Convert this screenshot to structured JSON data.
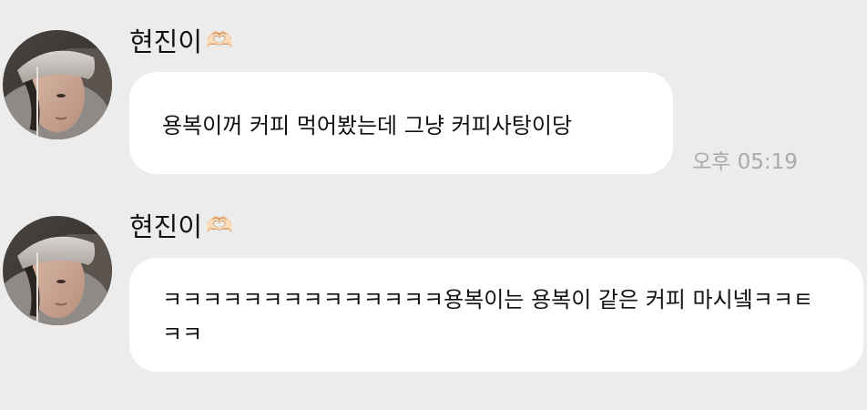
{
  "messages": [
    {
      "sender": "현진이",
      "sender_emoji": "🫶🏻",
      "text": "용복이꺼 커피 먹어봤는데 그냥 커피사탕이당",
      "time": "오후 05:19"
    },
    {
      "sender": "현진이",
      "sender_emoji": "🫶🏻",
      "text": "ㅋㅋㅋㅋㅋㅋㅋㅋㅋㅋㅋㅋㅋㅋ용복이는 용복이 같은 커피 마시넼ㅋㅋㅌㅋㅋ"
    }
  ],
  "colors": {
    "background": "#ececed",
    "bubble": "#ffffff",
    "timestamp": "#a9a9ae"
  },
  "icons": {
    "avatar": "profile-photo",
    "sender_emoji": "heart-hands-emoji"
  }
}
